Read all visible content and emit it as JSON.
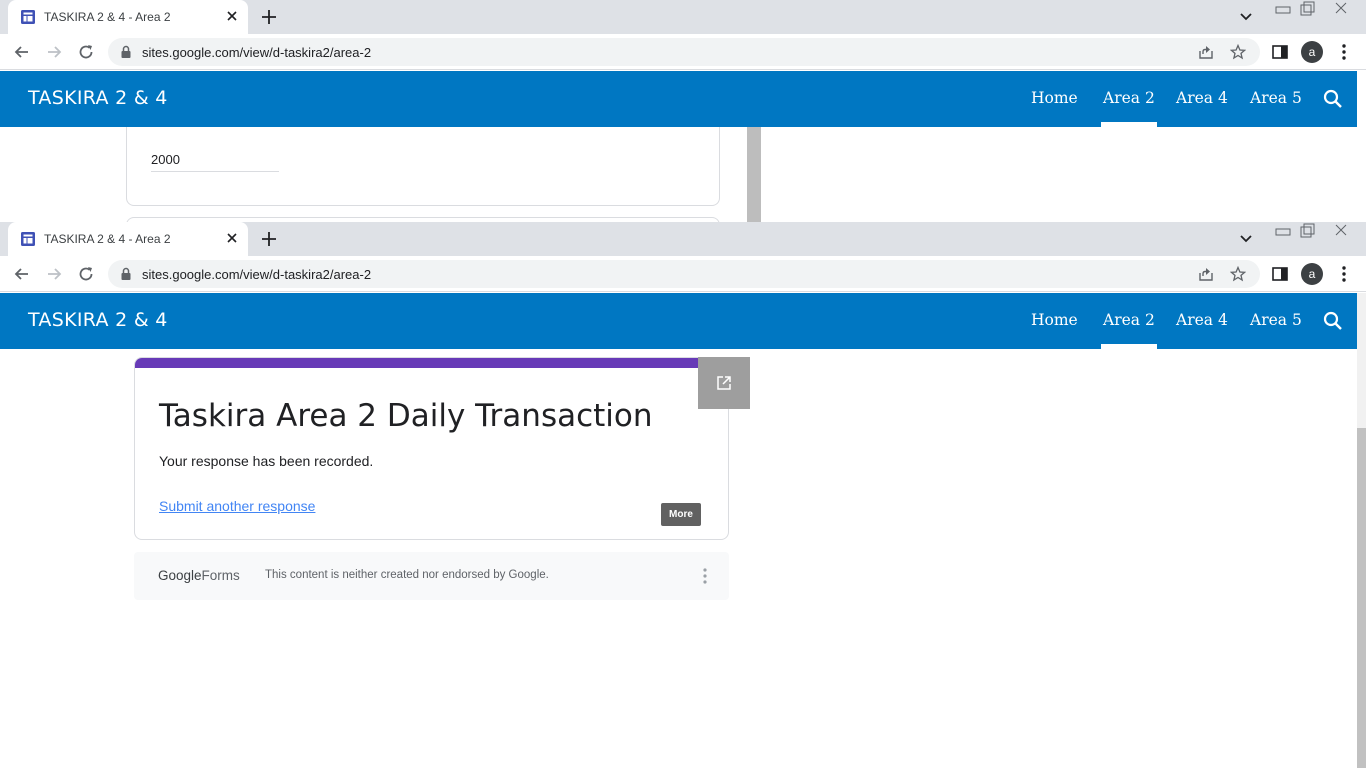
{
  "window_top": {
    "tab": {
      "title": "TASKIRA 2 & 4 - Area 2"
    },
    "url": "sites.google.com/view/d-taskira2/area-2",
    "profile_initial": "a",
    "site": {
      "brand": "TASKIRA 2 & 4",
      "nav": [
        "Home",
        "Area 2",
        "Area 4",
        "Area 5"
      ],
      "active_nav": "Area 2"
    },
    "field_value": "2000"
  },
  "window_main": {
    "tab": {
      "title": "TASKIRA 2 & 4 - Area 2"
    },
    "url": "sites.google.com/view/d-taskira2/area-2",
    "profile_initial": "a",
    "site": {
      "brand": "TASKIRA 2 & 4",
      "nav": [
        "Home",
        "Area 2",
        "Area 4",
        "Area 5"
      ],
      "active_nav": "Area 2"
    },
    "form": {
      "title": "Taskira Area 2 Daily Transaction",
      "message": "Your response has been recorded.",
      "link": "Submit another response",
      "more_label": "More",
      "accent_color": "#673ab7"
    },
    "footer": {
      "logo_google": "Google",
      "logo_forms": "Forms",
      "disclaimer": "This content is neither created nor endorsed by Google."
    }
  },
  "colors": {
    "site_header": "#0077c2",
    "tabstrip": "#dee1e6",
    "link": "#4285f4"
  },
  "icons": [
    "sites-favicon",
    "close-icon",
    "plus-icon",
    "chevron-down-icon",
    "minimize-icon",
    "restore-icon",
    "window-close-icon",
    "back-arrow-icon",
    "forward-arrow-icon",
    "reload-icon",
    "lock-icon",
    "share-icon",
    "star-icon",
    "side-panel-icon",
    "kebab-menu-icon",
    "search-icon",
    "open-in-new-icon"
  ]
}
